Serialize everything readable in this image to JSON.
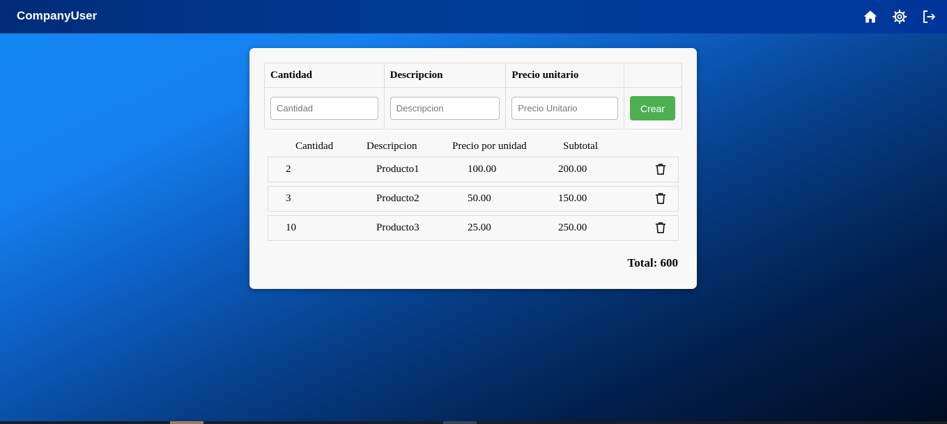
{
  "app": {
    "brand": "CompanyUser"
  },
  "nav": {
    "icons": [
      "home-icon",
      "gear-icon",
      "logout-icon"
    ]
  },
  "form": {
    "headers": {
      "cantidad": "Cantidad",
      "descripcion": "Descripcion",
      "precio": "Precio unitario"
    },
    "placeholders": {
      "cantidad": "Cantidad",
      "descripcion": "Descripcion",
      "precio": "Precio Unitario"
    },
    "values": {
      "cantidad": "",
      "descripcion": "",
      "precio": ""
    },
    "create_label": "Crear"
  },
  "list": {
    "headers": {
      "cantidad": "Cantidad",
      "descripcion": "Descripcion",
      "precio": "Precio por unidad",
      "subtotal": "Subtotal"
    },
    "items": [
      {
        "cantidad": "2",
        "descripcion": "Producto1",
        "precio": "100.00",
        "subtotal": "200.00"
      },
      {
        "cantidad": "3",
        "descripcion": "Producto2",
        "precio": "50.00",
        "subtotal": "150.00"
      },
      {
        "cantidad": "10",
        "descripcion": "Producto3",
        "precio": "25.00",
        "subtotal": "250.00"
      }
    ]
  },
  "total": "Total: 600",
  "colors": {
    "accent": "#4caf50",
    "navbar": "#003d99"
  }
}
